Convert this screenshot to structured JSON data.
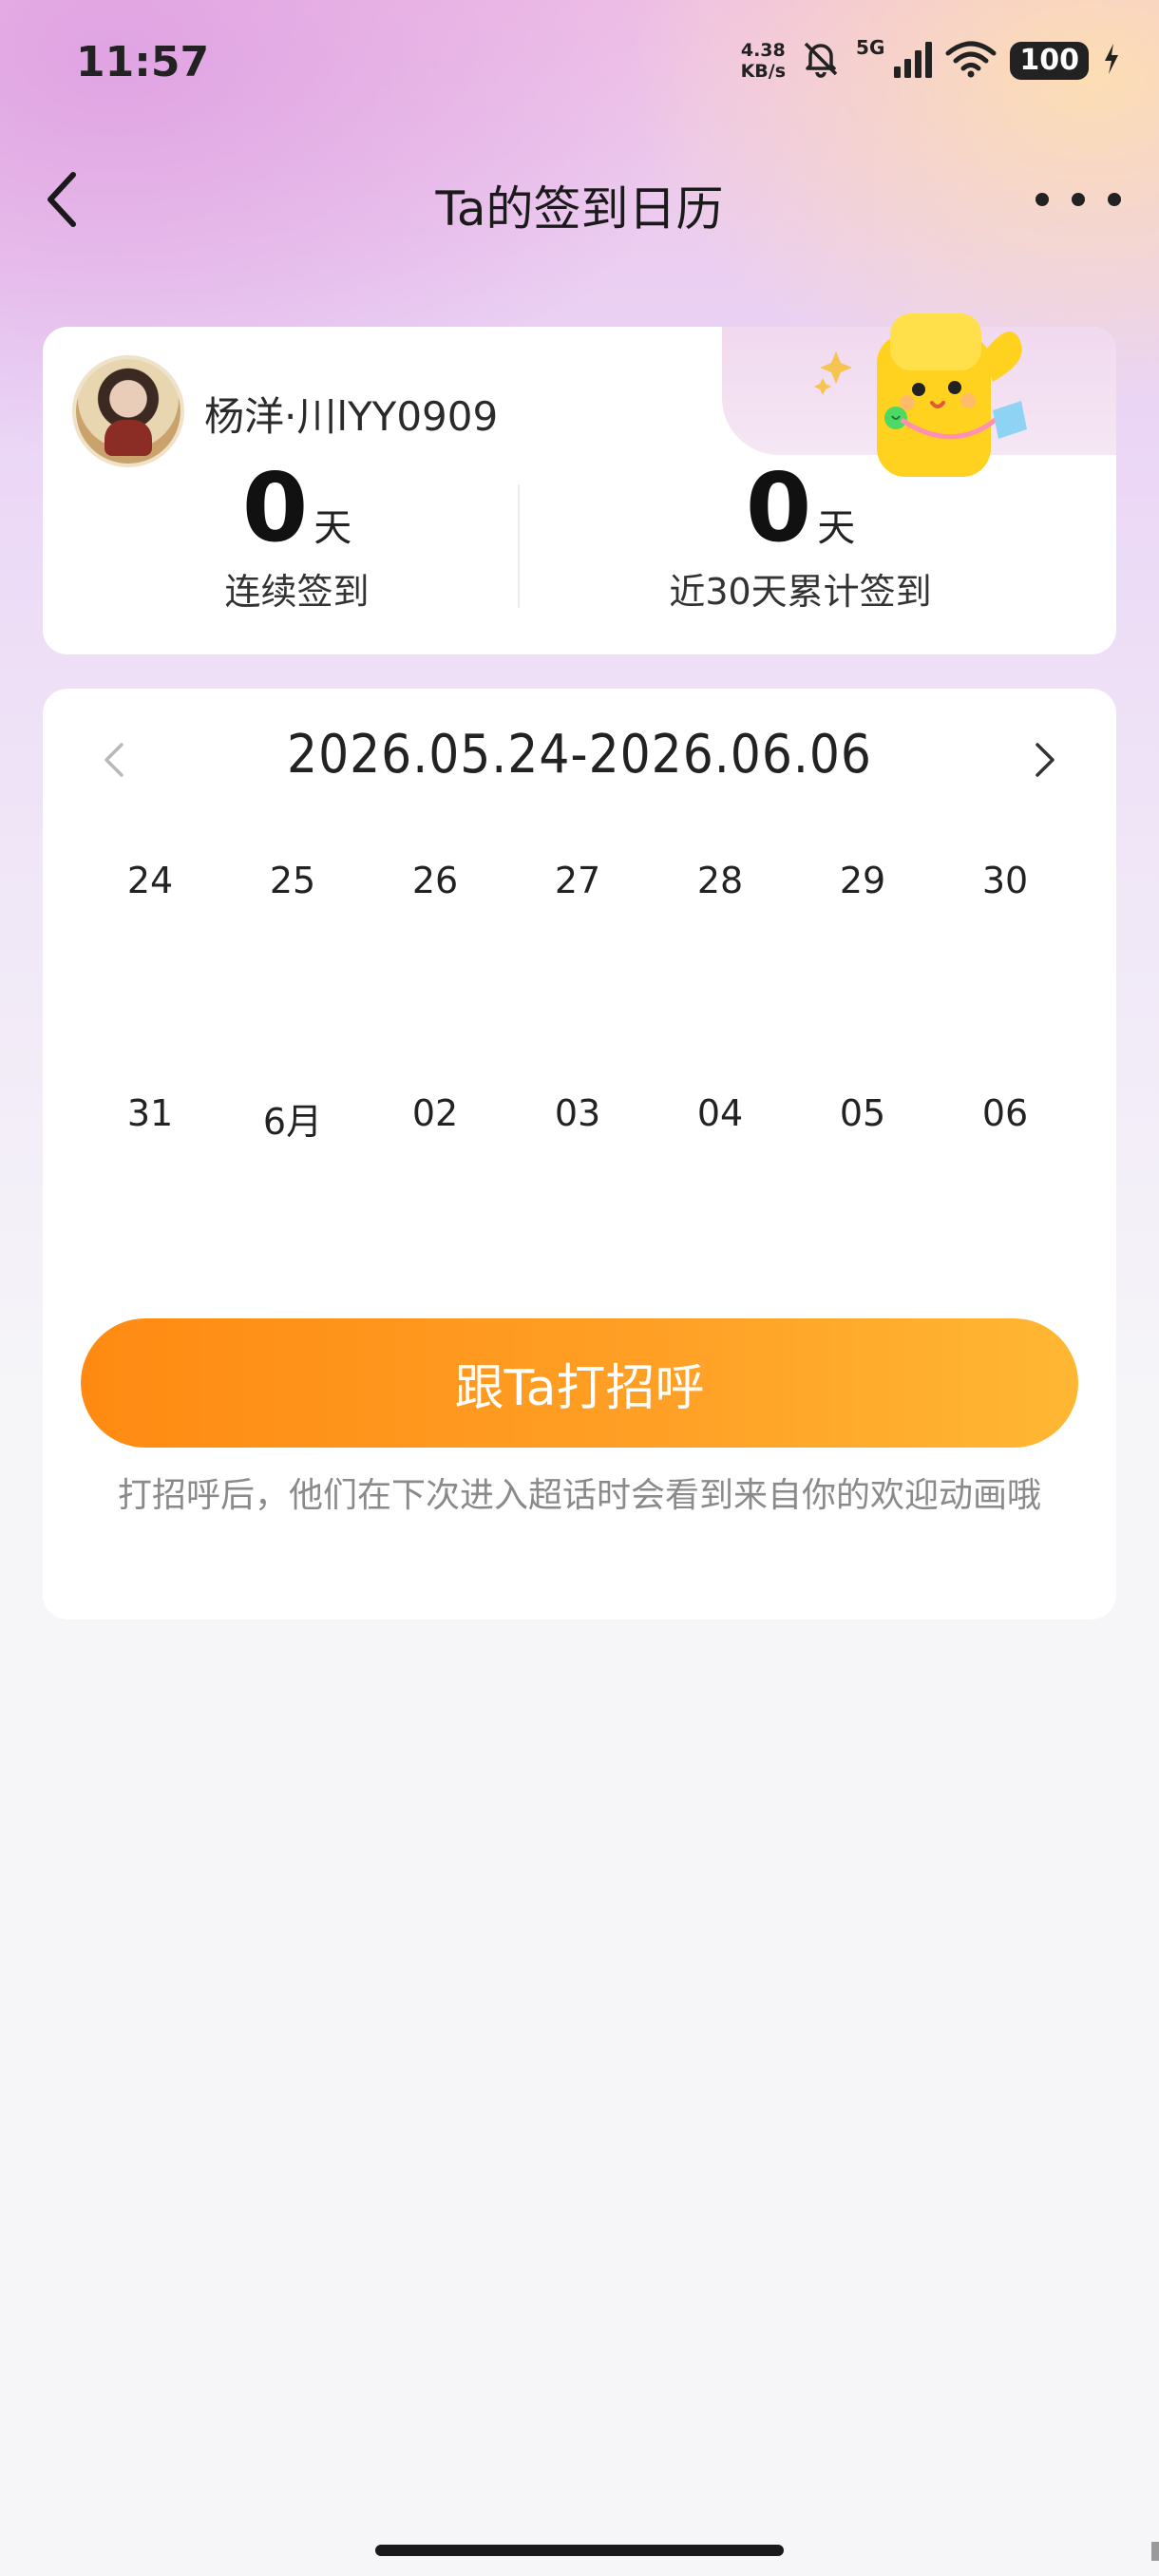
{
  "status_bar": {
    "time": "11:57",
    "net_speed_value": "4.38",
    "net_speed_unit": "KB/s",
    "signal_type": "5G",
    "battery": "100"
  },
  "nav": {
    "title": "Ta的签到日历"
  },
  "profile": {
    "username": "杨洋·川lYY0909"
  },
  "stats": {
    "consecutive": {
      "value": "0",
      "unit": "天",
      "label": "连续签到"
    },
    "last30": {
      "value": "0",
      "unit": "天",
      "label": "近30天累计签到"
    }
  },
  "calendar": {
    "range": "2026.05.24-2026.06.06",
    "week1": [
      "24",
      "25",
      "26",
      "27",
      "28",
      "29",
      "30"
    ],
    "week2": [
      "31",
      "6月",
      "02",
      "03",
      "04",
      "05",
      "06"
    ]
  },
  "greet": {
    "button_label": "跟Ta打招呼",
    "hint": "打招呼后，他们在下次进入超话时会看到来自你的欢迎动画哦"
  },
  "colors": {
    "accent_orange": "#ff8a12",
    "accent_orange_light": "#ffb733",
    "mascot_yellow": "#ffd21f"
  }
}
